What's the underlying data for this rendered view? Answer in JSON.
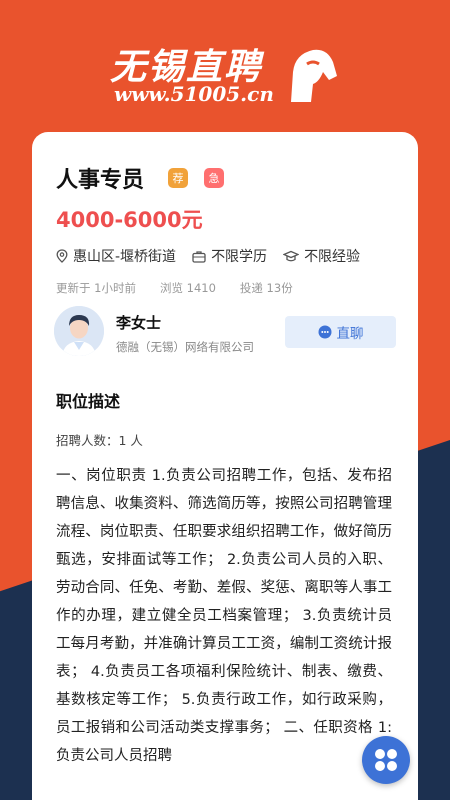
{
  "brand": {
    "title": "无锡直聘",
    "url": "www.51005.cn",
    "colors": {
      "primary": "#e9532d",
      "navy": "#1c3050"
    }
  },
  "job": {
    "title": "人事专员",
    "badge_recommended": "荐",
    "badge_urgent": "急",
    "salary": "4000-6000元",
    "location": "惠山区-堰桥街道",
    "education": "不限学历",
    "experience": "不限经验",
    "updated": "更新于 1小时前",
    "views": "浏览 1410",
    "applications": "投递 13份"
  },
  "recruiter": {
    "name": "李女士",
    "company": "德融（无锡）网络有限公司",
    "chat_label": "直聊"
  },
  "description": {
    "section_title": "职位描述",
    "headcount": "招聘人数：1 人",
    "text": "一、岗位职责 1.负责公司招聘工作，包括、发布招聘信息、收集资料、筛选简历等，按照公司招聘管理流程、岗位职责、任职要求组织招聘工作，做好简历甄选，安排面试等工作； 2.负责公司人员的入职、劳动合同、任免、考勤、差假、奖惩、离职等人事工作的办理，建立健全员工档案管理； 3.负责统计员工每月考勤，并准确计算员工工资，编制工资统计报表； 4.负责员工各项福利保险统计、制表、缴费、基数核定等工作； 5.负责行政工作，如行政采购，员工报销和公司活动类支撑事务； 二、任职资格 1:负责公司人员招聘"
  },
  "icons": {
    "location": "location-icon",
    "education": "briefcase-icon",
    "experience": "graduation-cap-icon",
    "chat": "chat-bubble-icon",
    "fab": "grid-menu-icon"
  }
}
